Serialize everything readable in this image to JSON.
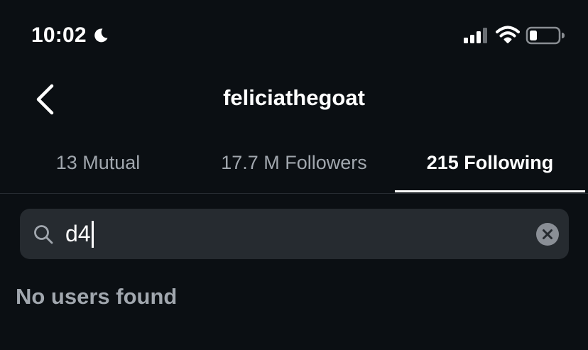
{
  "status_bar": {
    "time": "10:02",
    "icons": [
      "moon-icon",
      "signal-icon",
      "wifi-icon",
      "battery-icon"
    ]
  },
  "nav": {
    "back_icon": "chevron-left-icon",
    "title": "feliciathegoat"
  },
  "tabs": [
    {
      "label": "13 Mutual",
      "active": false
    },
    {
      "label": "17.7 M Followers",
      "active": false
    },
    {
      "label": "215 Following",
      "active": true
    }
  ],
  "search": {
    "value": "d4",
    "icon": "search-icon",
    "clear_icon": "clear-icon"
  },
  "results": {
    "empty_message": "No users found"
  },
  "colors": {
    "background": "#0b0f13",
    "search_field": "#262b30",
    "muted_text": "#a1a7ae",
    "active_text": "#ffffff"
  }
}
